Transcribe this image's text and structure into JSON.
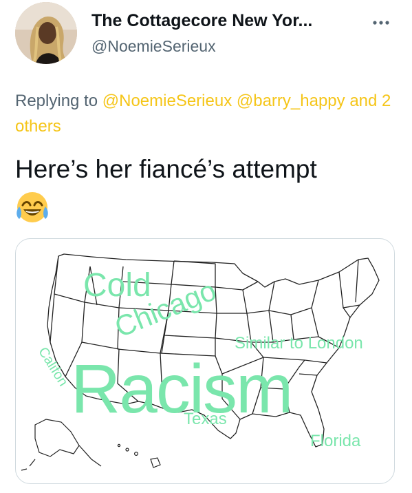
{
  "tweet": {
    "author": {
      "display_name": "The Cottagecore New Yor...",
      "handle": "@NoemieSerieux",
      "avatar": "profile-photo"
    },
    "more_icon": "more-horizontal-icon",
    "reply": {
      "prefix": "Replying to",
      "mention_1": "@NoemieSerieux",
      "mention_2": "@barry_happy",
      "others": "and 2 others"
    },
    "text": "Here’s her fiancé’s attempt",
    "emoji": "face-with-tears-of-joy",
    "media": {
      "type": "us-map-word-overlay",
      "labels": {
        "cold": "Cold",
        "chicago": "Chicago",
        "similar": "Similar to London",
        "california": "Califon",
        "racism": "Racism",
        "texas": "Texas",
        "florida": "Florida"
      }
    }
  },
  "colors": {
    "text": "#0f1419",
    "secondary": "#536471",
    "mention": "#f5c518",
    "map_word": "#7ae6ac",
    "card_border": "#cfd9de"
  }
}
